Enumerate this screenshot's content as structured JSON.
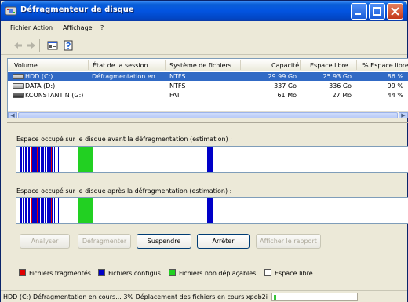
{
  "window": {
    "title": "Défragmenteur de disque"
  },
  "menu": [
    "Fichier",
    "Action",
    "Affichage",
    "?"
  ],
  "toolbar": {
    "icons": [
      "back-arrow-icon",
      "forward-arrow-icon",
      "properties-icon",
      "help-icon"
    ]
  },
  "volumes": {
    "columns": [
      "Volume",
      "État de la session",
      "Système de fichiers",
      "Capacité",
      "Espace libre",
      "% Espace libre"
    ],
    "rows": [
      {
        "volume": "HDD (C:)",
        "status": "Défragmentation en...",
        "fs": "NTFS",
        "capacity": "29.99 Go",
        "free": "25.93 Go",
        "pct": "86 %",
        "selected": true
      },
      {
        "volume": "DATA (D:)",
        "status": "",
        "fs": "NTFS",
        "capacity": "337 Go",
        "free": "336 Go",
        "pct": "99 %",
        "selected": false
      },
      {
        "volume": "KCONSTANTIN (G:)",
        "status": "",
        "fs": "FAT",
        "capacity": "61 Mo",
        "free": "27 Mo",
        "pct": "44 %",
        "selected": false
      }
    ]
  },
  "analysis": {
    "before_label": "Espace occupé sur le disque avant la défragmentation (estimation) :",
    "after_label": "Espace occupé sur le disque après la défragmentation (estimation) :"
  },
  "buttons": {
    "analyse": "Analyser",
    "defrag": "Défragmenter",
    "suspend": "Suspendre",
    "stop": "Arrêter",
    "report": "Afficher le rapport"
  },
  "legend": {
    "fragmented": "Fichiers fragmentés",
    "contiguous": "Fichiers contigus",
    "unmovable": "Fichiers non déplaçables",
    "free": "Espace libre"
  },
  "colors": {
    "fragmented": "#e00000",
    "contiguous": "#0000c8",
    "unmovable": "#22d022",
    "free": "#ffffff",
    "selection": "#316ac5",
    "titlebar": "#0054e3"
  },
  "status": {
    "text": "HDD (C:) Défragmentation en cours... 3%  Déplacement des fichiers en cours xpob2i",
    "progress_percent": 3
  }
}
